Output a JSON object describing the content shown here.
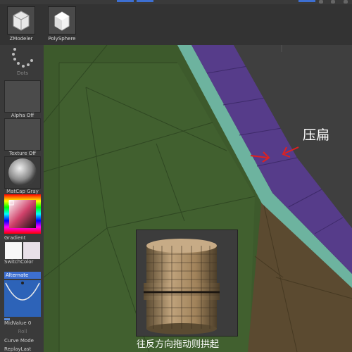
{
  "toolbar": {
    "tools": [
      {
        "label": "ZModeler",
        "icon": "zmodeler-cube-icon"
      },
      {
        "label": "PolySphere",
        "icon": "polysphere-cube-icon"
      }
    ]
  },
  "sidebar": {
    "dots_label": "Dots",
    "alpha_label": "Alpha Off",
    "texture_label": "Texture Off",
    "material_label": "MatCap Gray",
    "gradient_label": "Gradient",
    "switchcolor_label": "SwitchColor",
    "alternate_label": "Alternate",
    "midvalue_label": "MidValue 0",
    "roll_label": "Roll",
    "curve_mode_label": "Curve Mode",
    "replay_last_label": "ReplayLast"
  },
  "viewport": {
    "annotation_flatten": "压扁",
    "caption": "往反方向拖动则拱起"
  },
  "colors": {
    "purple_band": "#5b3f8c",
    "teal_edge": "#6fb3a0",
    "green_mesh": "#3f5a2c",
    "brown_mesh": "#5a4a30",
    "arrow_red": "#e0201f",
    "accent_blue": "#3d6fd1"
  }
}
